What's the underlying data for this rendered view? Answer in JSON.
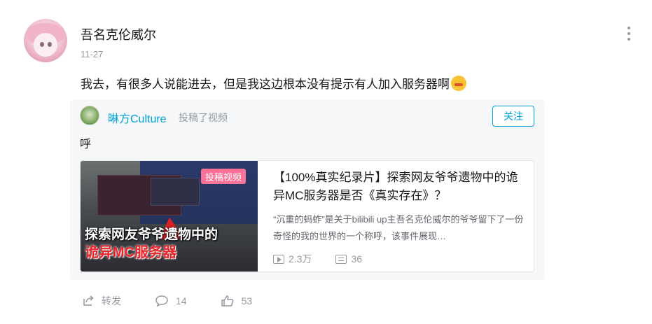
{
  "comment": {
    "username": "吾名克伦威尔",
    "time": "11-27",
    "text": "我去，有很多人说能进去，但是我这边根本没有提示有人加入服务器啊"
  },
  "repost": {
    "uploader_name": "晽方Culture",
    "action_text": "投稿了视频",
    "follow_label": "关注",
    "text": "呼",
    "video": {
      "badge": "投稿视频",
      "cover_text_line1": "探索网友爷爷遗物中的",
      "cover_text_line2": "诡异MC服务器",
      "title": "【100%真实纪录片】探索网友爷爷遗物中的诡异MC服务器是否《真实存在》？",
      "description": "“沉重的蚂蚱”是关于bilibili up主吾名克伦威尔的爷爷留下了一份奇怪的我的世界的一个称呼，该事件展现…",
      "views": "2.3万",
      "danmaku": "36"
    }
  },
  "actions": {
    "forward_label": "转发",
    "comment_count": "14",
    "like_count": "53"
  },
  "colors": {
    "link_blue": "#00a1d6",
    "badge_pink": "#fb7299",
    "muted_gray": "#9499a0",
    "card_bg": "#f6f7f8"
  }
}
